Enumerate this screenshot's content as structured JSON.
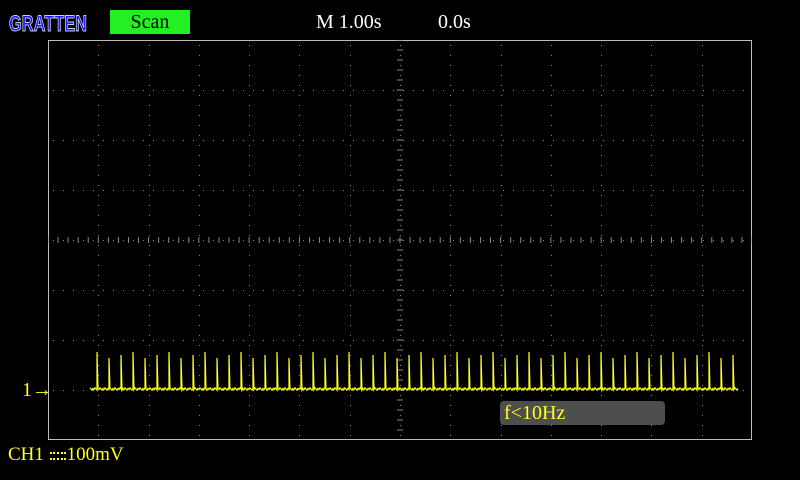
{
  "brand": {
    "logo_text": "GRATTEN"
  },
  "top_bar": {
    "mode": "Scan",
    "timebase": "M 1.00s",
    "trigger_position": "0.0s"
  },
  "channel": {
    "marker": "1",
    "arrow": "→",
    "name": "CH1",
    "volts_per_div": "100mV",
    "coupling_icon": "dc-coupling-icon"
  },
  "measurement": {
    "frequency": "f<10Hz"
  },
  "colors": {
    "background": "#000000",
    "grid": "#8a8a8a",
    "trace": "#ffff22",
    "mode_badge": "#22f022",
    "logo": "#1a1aff",
    "frequency_box": "#4e4e4e"
  },
  "grid": {
    "h_divisions": 14,
    "v_divisions": 8
  }
}
